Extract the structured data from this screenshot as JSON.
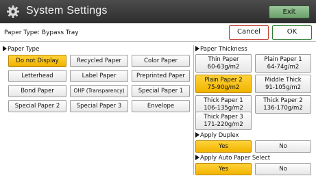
{
  "header": {
    "title": "System Settings",
    "exit_label": "Exit",
    "gear_icon": "gear-icon"
  },
  "subbar": {
    "paper_type_label": "Paper Type: Bypass Tray",
    "cancel_label": "Cancel",
    "ok_label": "OK"
  },
  "colors": {
    "selected": "#f5c000",
    "cancel_border": "#c0392b",
    "ok_border": "#2e7d32",
    "exit_bg": "#86b886"
  },
  "paper_type": {
    "heading": "Paper Type",
    "options": [
      {
        "label": "Do not Display",
        "selected": true
      },
      {
        "label": "Recycled Paper",
        "selected": false
      },
      {
        "label": "Color Paper",
        "selected": false
      },
      {
        "label": "Letterhead",
        "selected": false
      },
      {
        "label": "Label Paper",
        "selected": false
      },
      {
        "label": "Preprinted Paper",
        "selected": false
      },
      {
        "label": "Bond Paper",
        "selected": false
      },
      {
        "label": "OHP (Transparency)",
        "selected": false
      },
      {
        "label": "Special Paper 1",
        "selected": false
      },
      {
        "label": "Special Paper 2",
        "selected": false
      },
      {
        "label": "Special Paper 3",
        "selected": false
      },
      {
        "label": "Envelope",
        "selected": false
      }
    ]
  },
  "paper_thickness": {
    "heading": "Paper Thickness",
    "options": [
      {
        "line1": "Thin Paper",
        "line2": "60-63g/m2",
        "selected": false
      },
      {
        "line1": "Plain Paper 1",
        "line2": "64-74g/m2",
        "selected": false
      },
      {
        "line1": "Plain Paper 2",
        "line2": "75-90g/m2",
        "selected": true
      },
      {
        "line1": "Middle Thick",
        "line2": "91-105g/m2",
        "selected": false
      },
      {
        "line1": "Thick Paper 1",
        "line2": "106-135g/m2",
        "selected": false
      },
      {
        "line1": "Thick Paper 2",
        "line2": "136-170g/m2",
        "selected": false
      },
      {
        "line1": "Thick Paper 3",
        "line2": "171-220g/m2",
        "selected": false
      }
    ]
  },
  "apply_duplex": {
    "heading": "Apply Duplex",
    "yes_label": "Yes",
    "no_label": "No",
    "selected": "Yes"
  },
  "apply_auto": {
    "heading": "Apply Auto Paper Select",
    "yes_label": "Yes",
    "no_label": "No",
    "selected": "Yes"
  }
}
